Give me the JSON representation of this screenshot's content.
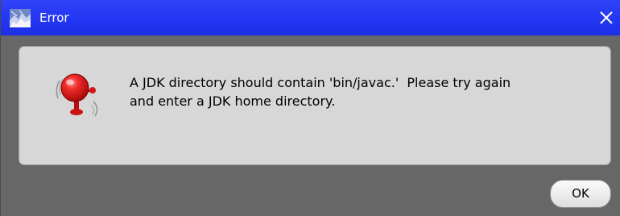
{
  "window": {
    "title": "Error",
    "title_icon": "java-duke-icon",
    "close_icon": "close-icon"
  },
  "message": {
    "icon": "alarm-bell-icon",
    "line1": "A JDK directory should contain 'bin/javac.'  Please try again",
    "line2": "and enter a JDK home directory."
  },
  "buttons": {
    "ok_label": "OK"
  },
  "colors": {
    "titlebar": "#2236f2",
    "window_background": "#676767",
    "panel_background": "#d7d7d7",
    "bell_red": "#e31b1b"
  }
}
